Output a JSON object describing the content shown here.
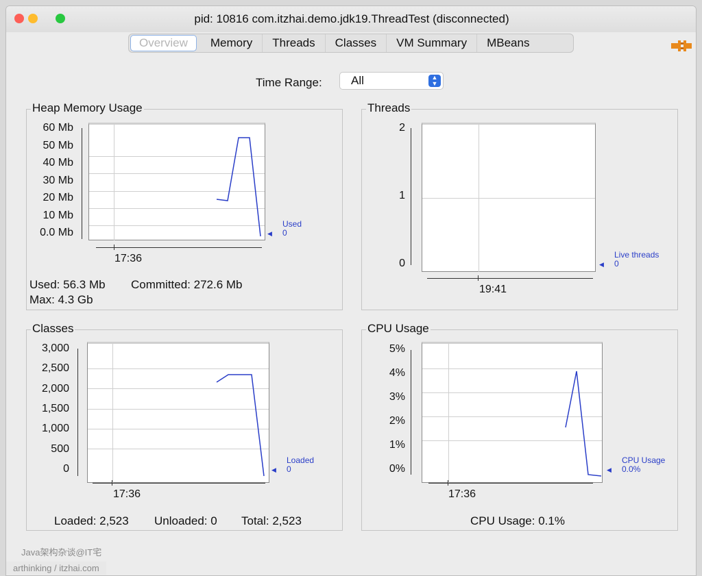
{
  "window": {
    "title": "pid: 10816 com.itzhai.demo.jdk19.ThreadTest (disconnected)"
  },
  "tabs": [
    {
      "label": "Overview",
      "selected": true
    },
    {
      "label": "Memory"
    },
    {
      "label": "Threads"
    },
    {
      "label": "Classes"
    },
    {
      "label": "VM Summary"
    },
    {
      "label": "MBeans"
    }
  ],
  "time_range": {
    "label": "Time Range:",
    "value": "All"
  },
  "charts": {
    "heap": {
      "title": "Heap Memory Usage",
      "yticks": [
        "60 Mb",
        "50 Mb",
        "40 Mb",
        "30 Mb",
        "20 Mb",
        "10 Mb",
        "0.0 Mb"
      ],
      "xtick": "17:36",
      "legend_name": "Used",
      "legend_value": "0",
      "stats": {
        "used": "Used: 56.3 Mb",
        "committed": "Committed: 272.6 Mb",
        "max": "Max: 4.3 Gb"
      }
    },
    "threads": {
      "title": "Threads",
      "yticks": [
        "2",
        "1",
        "0"
      ],
      "xtick": "19:41",
      "legend_name": "Live threads",
      "legend_value": "0"
    },
    "classes": {
      "title": "Classes",
      "yticks": [
        "3,000",
        "2,500",
        "2,000",
        "1,500",
        "1,000",
        "500",
        "0"
      ],
      "xtick": "17:36",
      "legend_name": "Loaded",
      "legend_value": "0",
      "stats": {
        "loaded": "Loaded: 2,523",
        "unloaded": "Unloaded: 0",
        "total": "Total: 2,523"
      }
    },
    "cpu": {
      "title": "CPU Usage",
      "yticks": [
        "5%",
        "4%",
        "3%",
        "2%",
        "1%",
        "0%"
      ],
      "xtick": "17:36",
      "legend_name": "CPU Usage",
      "legend_value": "0.0%",
      "stats": {
        "cpu": "CPU Usage: 0.1%"
      }
    }
  },
  "chart_data": [
    {
      "type": "line",
      "title": "Heap Memory Usage",
      "ylabel": "Mb",
      "ylim": [
        0,
        60
      ],
      "series": [
        {
          "name": "Used",
          "values": [
            21,
            20.5,
            56.3,
            56.3,
            0
          ]
        }
      ]
    },
    {
      "type": "line",
      "title": "Threads",
      "ylim": [
        0,
        2
      ],
      "series": [
        {
          "name": "Live threads",
          "values": [
            0
          ]
        }
      ]
    },
    {
      "type": "line",
      "title": "Classes",
      "ylim": [
        0,
        3000
      ],
      "series": [
        {
          "name": "Loaded",
          "values": [
            2300,
            2500,
            2500,
            0
          ]
        }
      ]
    },
    {
      "type": "line",
      "title": "CPU Usage",
      "ylim": [
        0,
        5
      ],
      "series": [
        {
          "name": "CPU Usage",
          "values": [
            2.0,
            4.4,
            0.1,
            0.0
          ]
        }
      ]
    }
  ],
  "watermarks": {
    "line1": "Java架构杂谈@IT宅",
    "line2": "arthinking / itzhai.com"
  },
  "colors": {
    "series": "#2a3ec8",
    "tab_selected_border": "#8fb3e6",
    "select_button": "#2f6fe0"
  }
}
